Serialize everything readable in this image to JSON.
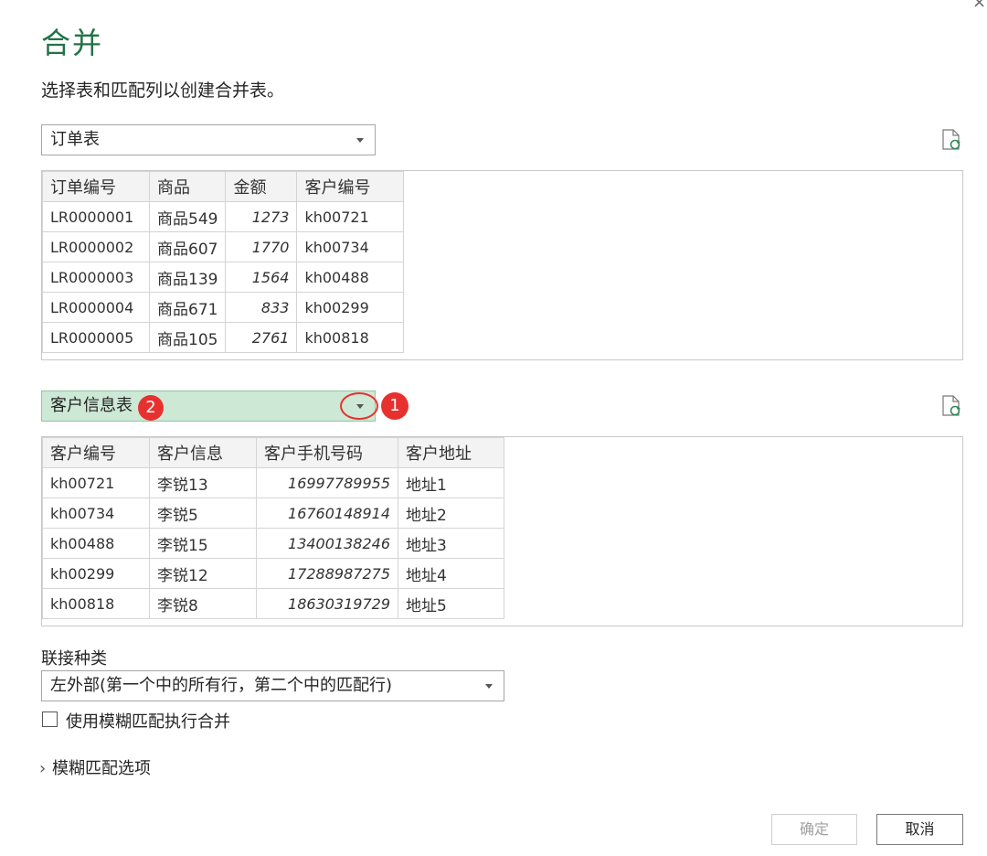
{
  "dialog": {
    "title": "合并",
    "subtitle": "选择表和匹配列以创建合并表。",
    "close_glyph": "×"
  },
  "table1": {
    "selected": "订单表",
    "headers": [
      "订单编号",
      "商品",
      "金额",
      "客户编号"
    ],
    "rows": [
      [
        "LR0000001",
        "商品549",
        "1273",
        "kh00721"
      ],
      [
        "LR0000002",
        "商品607",
        "1770",
        "kh00734"
      ],
      [
        "LR0000003",
        "商品139",
        "1564",
        "kh00488"
      ],
      [
        "LR0000004",
        "商品671",
        "833",
        "kh00299"
      ],
      [
        "LR0000005",
        "商品105",
        "2761",
        "kh00818"
      ]
    ]
  },
  "table2": {
    "selected": "客户信息表",
    "headers": [
      "客户编号",
      "客户信息",
      "客户手机号码",
      "客户地址"
    ],
    "rows": [
      [
        "kh00721",
        "李锐13",
        "16997789955",
        "地址1"
      ],
      [
        "kh00734",
        "李锐5",
        "16760148914",
        "地址2"
      ],
      [
        "kh00488",
        "李锐15",
        "13400138246",
        "地址3"
      ],
      [
        "kh00299",
        "李锐12",
        "17288987275",
        "地址4"
      ],
      [
        "kh00818",
        "李锐8",
        "18630319729",
        "地址5"
      ]
    ]
  },
  "annotations": {
    "marker1": "1",
    "marker2": "2",
    "color": "#e7312f"
  },
  "join": {
    "label": "联接种类",
    "selected": "左外部(第一个中的所有行，第二个中的匹配行)"
  },
  "fuzzy": {
    "checkbox_label": "使用模糊匹配执行合并",
    "checked": false,
    "options_label": "模糊匹配选项",
    "expand_glyph": "›"
  },
  "buttons": {
    "ok": "确定",
    "cancel": "取消"
  },
  "colors": {
    "title": "#217346",
    "selected_dropdown_bg": "#cde8d5"
  }
}
